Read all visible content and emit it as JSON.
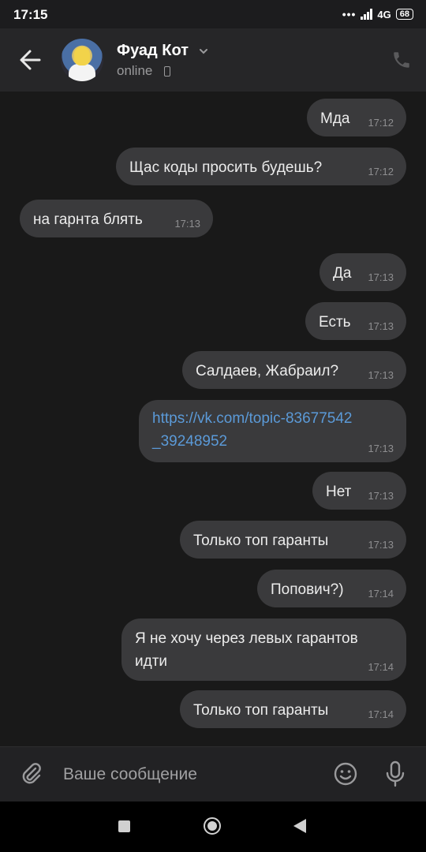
{
  "status_bar": {
    "time": "17:15",
    "dots": "•••",
    "network": "4G",
    "battery": "68"
  },
  "header": {
    "name": "Фуад Кот",
    "status": "online",
    "colors": {
      "background": "#262628",
      "accent": "#5b9ad8"
    }
  },
  "messages": [
    {
      "side": "out",
      "text": "Мда",
      "time": "17:12"
    },
    {
      "side": "out",
      "text": "Щас коды просить будешь?",
      "time": "17:12"
    },
    {
      "side": "in",
      "text": "на гарнта блять",
      "time": "17:13"
    },
    {
      "side": "out",
      "text": "Да",
      "time": "17:13"
    },
    {
      "side": "out",
      "text": "Есть",
      "time": "17:13"
    },
    {
      "side": "out",
      "text": "Салдаев, Жабраил?",
      "time": "17:13"
    },
    {
      "side": "out",
      "text": "https://vk.com/topic-83677542\n_39248952",
      "time": "17:13",
      "is_link": true
    },
    {
      "side": "out",
      "text": "Нет",
      "time": "17:13"
    },
    {
      "side": "out",
      "text": "Только топ гаранты",
      "time": "17:13"
    },
    {
      "side": "out",
      "text": "Попович?)",
      "time": "17:14"
    },
    {
      "side": "out",
      "text": "Я не хочу через левых гарантов\nидти",
      "time": "17:14"
    },
    {
      "side": "out",
      "text": "Только топ гаранты",
      "time": "17:14"
    }
  ],
  "composer": {
    "placeholder": "Ваше сообщение"
  },
  "icons": {
    "back": "arrow-left-icon",
    "call": "phone-icon",
    "attach": "paperclip-icon",
    "emoji": "smiley-icon",
    "mic": "microphone-icon",
    "chevron": "chevron-down-icon"
  }
}
